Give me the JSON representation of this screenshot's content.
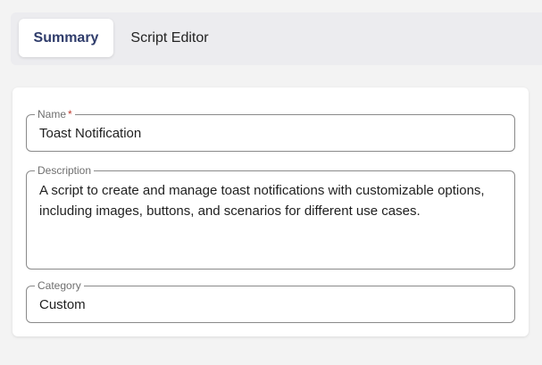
{
  "tabs": {
    "summary_label": "Summary",
    "script_editor_label": "Script Editor"
  },
  "form": {
    "name": {
      "label": "Name",
      "required_marker": "*",
      "value": "Toast Notification"
    },
    "description": {
      "label": "Description",
      "value": "A script to create and manage toast notifications with customizable options, including images, buttons, and scenarios for different use cases."
    },
    "category": {
      "label": "Category",
      "value": "Custom"
    }
  },
  "colors": {
    "active_tab_text": "#2f3c6b",
    "required_marker": "#c0392b",
    "field_border": "#8a8a8a",
    "tabbar_background": "#ececef"
  }
}
